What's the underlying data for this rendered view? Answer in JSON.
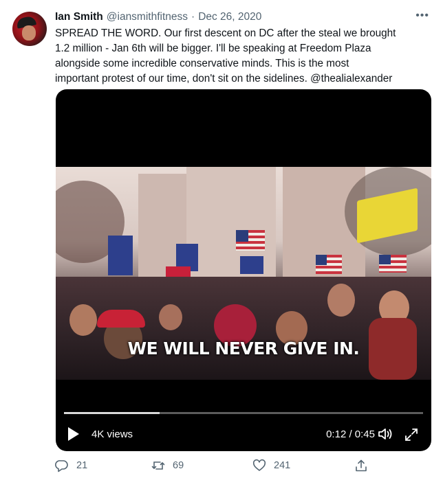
{
  "tweet": {
    "author_name": "Ian Smith",
    "handle": "@iansmithfitness",
    "separator": "·",
    "date": "Dec 26, 2020",
    "more_icon": "more-icon",
    "text_lines": [
      "SPREAD THE WORD. Our first descent on DC after the steal we brought",
      "1.2 million - Jan 6th will be bigger. I'll be speaking at Freedom Plaza",
      "alongside some incredible conservative minds. This is the most",
      "important protest of our time, don't sit on the sidelines. @thealialexander"
    ]
  },
  "video": {
    "caption": "WE WILL NEVER GIVE IN.",
    "views": "4K views",
    "time": "0:12 / 0:45",
    "progress_fraction": 0.267
  },
  "actions": {
    "reply_count": "21",
    "retweet_count": "69",
    "like_count": "241"
  },
  "colors": {
    "text": "#0f1419",
    "secondary": "#536471",
    "video_bg": "#000000"
  }
}
